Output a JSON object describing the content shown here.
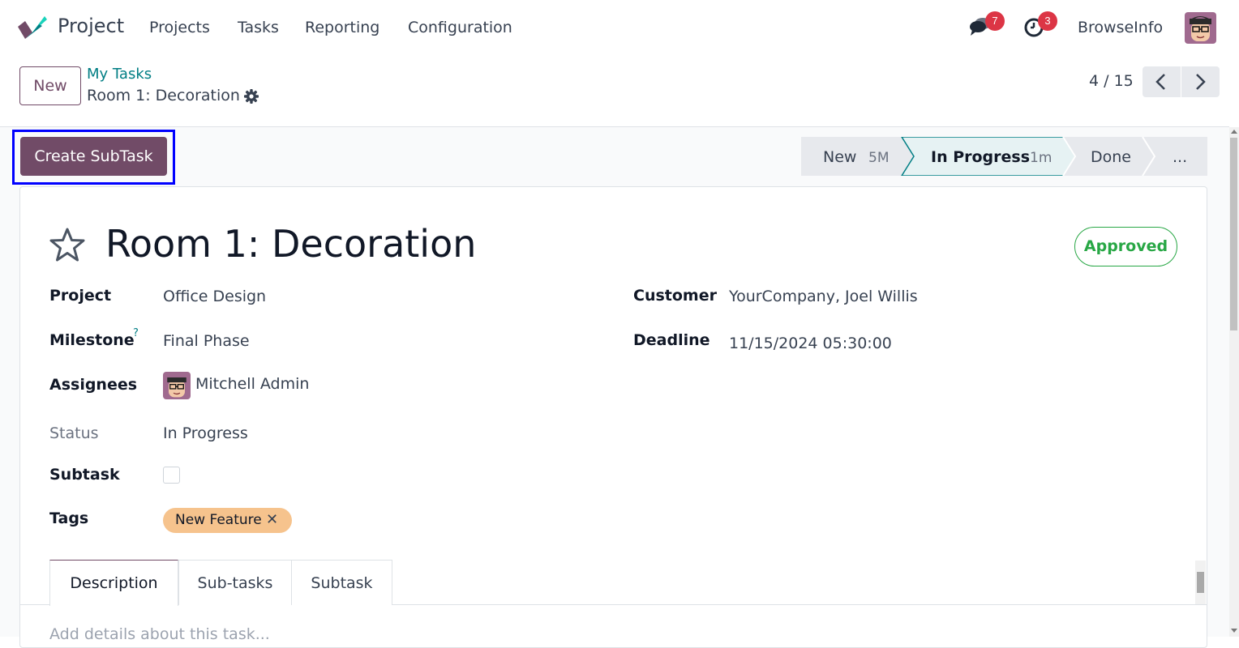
{
  "navbar": {
    "app_name": "Project",
    "menu": [
      "Projects",
      "Tasks",
      "Reporting",
      "Configuration"
    ],
    "messages_count": "7",
    "activities_count": "3",
    "company": "BrowseInfo"
  },
  "control_panel": {
    "new_label": "New",
    "breadcrumb_parent": "My Tasks",
    "breadcrumb_current": "Room 1: Decoration",
    "pager": "4 / 15"
  },
  "action": {
    "create_subtask_label": "Create SubTask"
  },
  "statusbar": {
    "stages": [
      {
        "name": "New",
        "time": "5M"
      },
      {
        "name": "In Progress",
        "time": "1m"
      },
      {
        "name": "Done",
        "time": ""
      }
    ],
    "more_label": "...",
    "active_stage": "In Progress"
  },
  "form": {
    "title": "Room 1: Decoration",
    "approval_state": "Approved",
    "fields": {
      "project_label": "Project",
      "project_value": "Office Design",
      "milestone_label": "Milestone",
      "milestone_help": "?",
      "milestone_value": "Final Phase",
      "assignees_label": "Assignees",
      "assignees_value": "Mitchell Admin",
      "status_label": "Status",
      "status_value": "In Progress",
      "subtask_label": "Subtask",
      "tags_label": "Tags",
      "tag_value": "New Feature",
      "tag_remove": "✕",
      "customer_label": "Customer",
      "customer_value": "YourCompany, Joel Willis",
      "deadline_label": "Deadline",
      "deadline_value": "11/15/2024 05:30:00"
    },
    "tabs": [
      "Description",
      "Sub-tasks",
      "Subtask"
    ],
    "description_placeholder": "Add details about this task..."
  },
  "colors": {
    "brand": "#714b67",
    "link": "#017e84",
    "badge": "#dc3545",
    "approved": "#28a745",
    "tag": "#f6c38d",
    "highlight": "#0000ff"
  },
  "icons": [
    "project-logo-icon",
    "chat-icon",
    "clock-icon",
    "gear-icon",
    "chevron-left-icon",
    "chevron-right-icon",
    "star-icon",
    "close-icon"
  ]
}
